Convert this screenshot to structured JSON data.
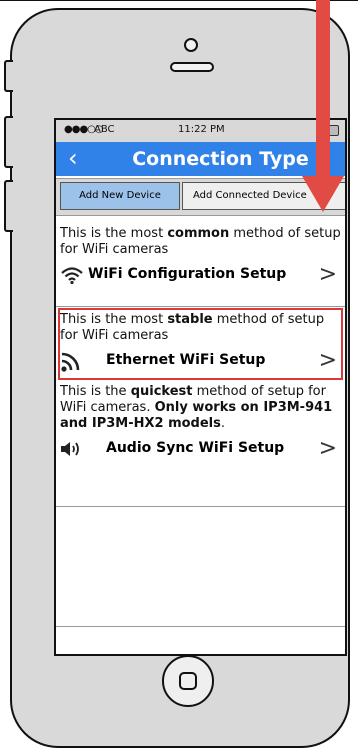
{
  "status_bar": {
    "signal": "●●●○○",
    "carrier": "ABC",
    "time": "11:22 PM"
  },
  "nav": {
    "back_icon": "chevron-left-icon",
    "title": "Connection Type"
  },
  "tabs": [
    {
      "label": "Add New Device",
      "active": true
    },
    {
      "label": "Add Connected Device",
      "active": false
    }
  ],
  "options": [
    {
      "desc_pre": "This is the most ",
      "desc_bold": "common",
      "desc_post": " method of setup for WiFi cameras",
      "icon": "wifi-icon",
      "label": "WiFi Configuration Setup"
    },
    {
      "desc_pre": "This is the most ",
      "desc_bold": "stable",
      "desc_post": " method of setup for WiFi cameras",
      "icon": "rss-signal-icon",
      "label": "Ethernet WiFi Setup"
    },
    {
      "desc_pre": "This is the ",
      "desc_bold": "quickest",
      "desc_post": " method of setup for WiFi cameras. ",
      "desc_bold2": "Only works on IP3M-941 and IP3M-HX2 models",
      "desc_end": ".",
      "icon": "speaker-icon",
      "label": "Audio Sync WiFi Setup"
    }
  ],
  "chevron": ">",
  "colors": {
    "nav_blue": "#3182e8",
    "highlight_red": "#d9393b",
    "arrow_red": "#e24b43",
    "tab_active": "#9cc2ea"
  }
}
